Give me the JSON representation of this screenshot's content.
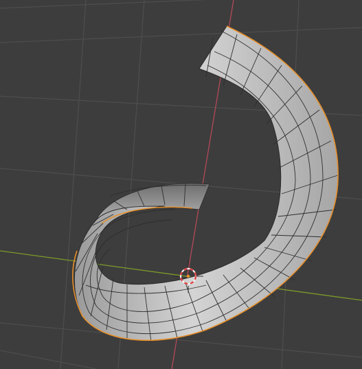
{
  "viewport": {
    "background": "#3d3d3d",
    "grid_color": "#4d4d4d",
    "x_axis_color": "#7c9a2a",
    "y_axis_color": "#b34a58"
  },
  "mesh": {
    "name": "spiral-tube-mesh",
    "face_light": "#cfcfcf",
    "face_dark": "#8a8a8a",
    "wire_color": "#2a2a2a",
    "selection_outline": "#e8902a"
  },
  "cursor3d": {
    "ring_red": "#e03c3c",
    "ring_white": "#f2f2f2"
  }
}
